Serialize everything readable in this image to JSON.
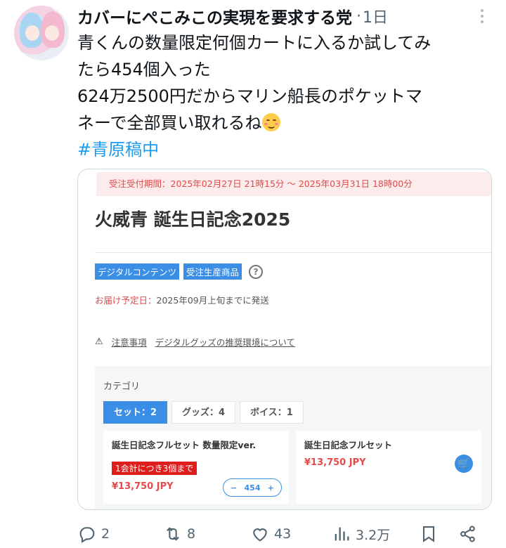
{
  "tweet": {
    "author_name": "カバーにぺこみこの実現を要求する党",
    "separator": "·",
    "time": "1日",
    "text_lines": [
      "青くんの数量限定何個カートに入るか試してみ",
      "たら454個入った",
      "624万2500円だからマリン船長のポケットマ",
      "ネーで全部買い取れるね"
    ],
    "hashtag": "#青原稿中"
  },
  "media": {
    "banner": "受注受付期間：2025年02月27日 21時15分 〜 2025年03月31日 18時00分",
    "title": "火威青 誕生日記念2025",
    "tags": [
      "デジタルコンテンツ",
      "受注生産商品"
    ],
    "help_glyph": "?",
    "delivery_label": "お届け予定日：",
    "delivery_value": "2025年09月上旬までに発送",
    "warning_glyph": "⚠",
    "notes_link": "注意事項",
    "digital_link": "デジタルグッズの推奨環境について",
    "category_label": "カテゴリ",
    "tabs": [
      {
        "label": "セット：2",
        "active": true
      },
      {
        "label": "グッズ：4",
        "active": false
      },
      {
        "label": "ボイス：1",
        "active": false
      }
    ],
    "products": [
      {
        "name": "誕生日記念フルセット 数量限定ver.",
        "limit": "1会計につき3個まで",
        "price": "¥13,750 JPY",
        "stepper_minus": "−",
        "quantity": "454",
        "stepper_plus": "+"
      },
      {
        "name": "誕生日記念フルセット",
        "price": "¥13,750 JPY",
        "cart_glyph": "🛒"
      }
    ]
  },
  "actions": {
    "replies": "2",
    "retweets": "8",
    "likes": "43",
    "views": "3.2万"
  },
  "colors": {
    "accent": "#1d9bf0",
    "muted": "#536471",
    "shop_blue": "#3b8ee6",
    "shop_red": "#e24b4b"
  },
  "icons": [
    "more-icon",
    "smiling-face-emoji",
    "reply-icon",
    "retweet-icon",
    "like-icon",
    "views-icon",
    "bookmark-icon",
    "share-icon",
    "warning-icon",
    "help-icon",
    "cart-icon"
  ]
}
